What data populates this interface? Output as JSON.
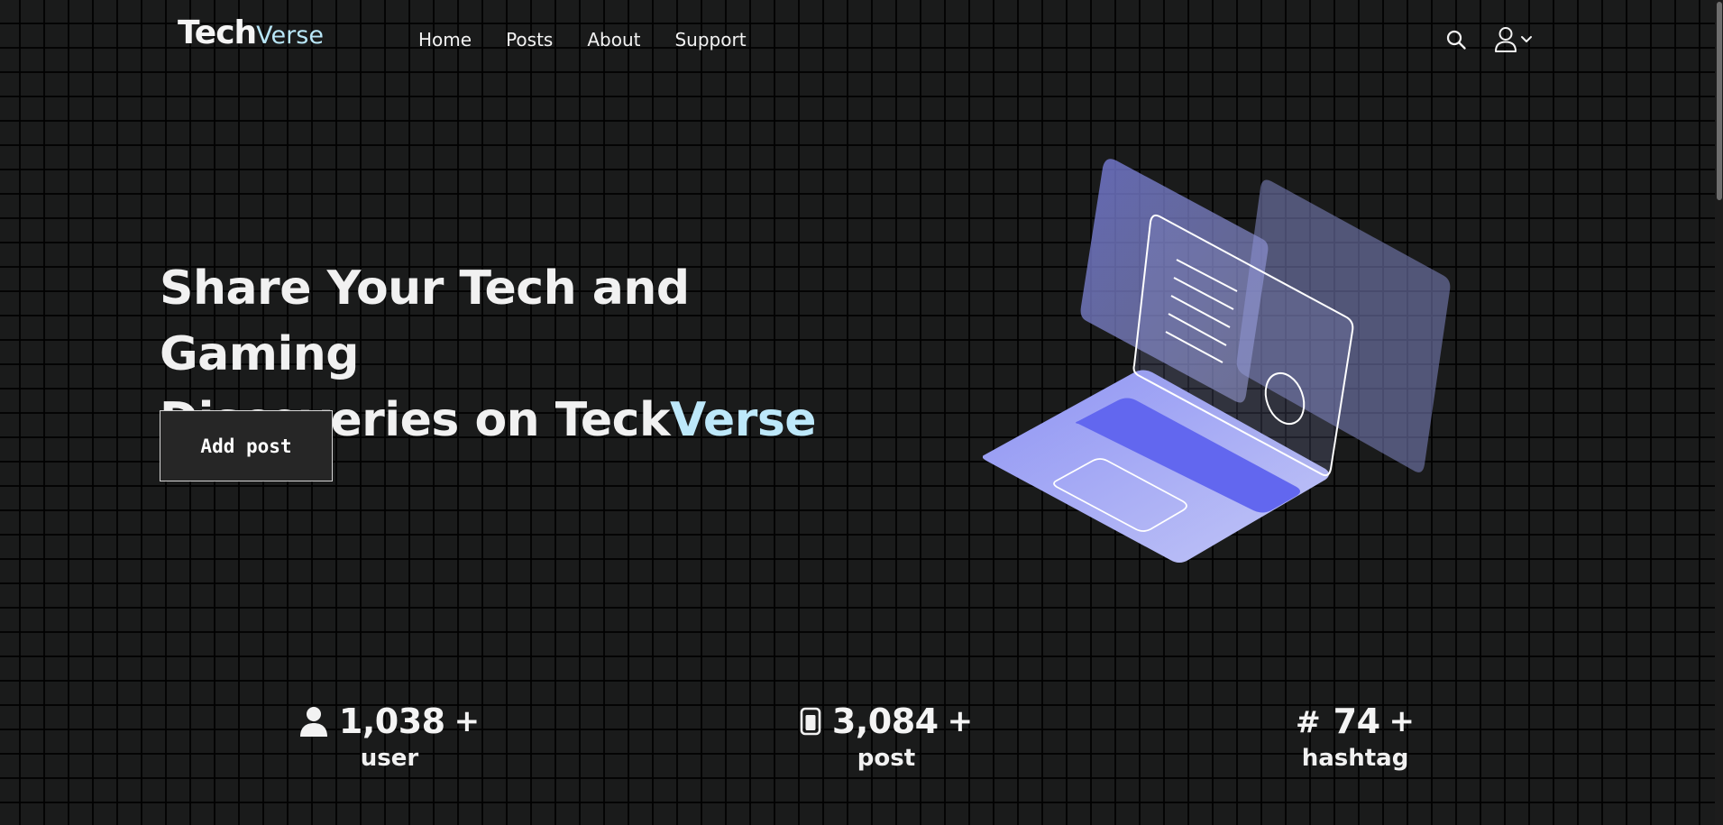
{
  "header": {
    "logo_primary": "Tech",
    "logo_accent": "Verse",
    "nav": [
      {
        "label": "Home"
      },
      {
        "label": "Posts"
      },
      {
        "label": "About"
      },
      {
        "label": "Support"
      }
    ],
    "icons": [
      "search-icon",
      "user-icon",
      "chevron-down-icon"
    ]
  },
  "hero": {
    "title_line1": "Share Your Tech and Gaming",
    "title_line2_prefix": "Discoveries on Teck",
    "title_line2_accent": "Verse",
    "add_post_label": "Add post",
    "illustration": "laptop-with-floating-panels"
  },
  "stats": [
    {
      "icon": "user-icon",
      "value": "1,038",
      "suffix": "+",
      "label": "user"
    },
    {
      "icon": "document-icon",
      "value": "3,084",
      "suffix": "+",
      "label": "post"
    },
    {
      "icon": "hash",
      "value": "74",
      "suffix": "+",
      "label": "hashtag",
      "symbol": "#"
    }
  ],
  "colors": {
    "background": "#1a1b1b",
    "accent": "#bde8fa",
    "illustration_primary": "#6c70f2",
    "illustration_light": "#aeb3f8"
  }
}
